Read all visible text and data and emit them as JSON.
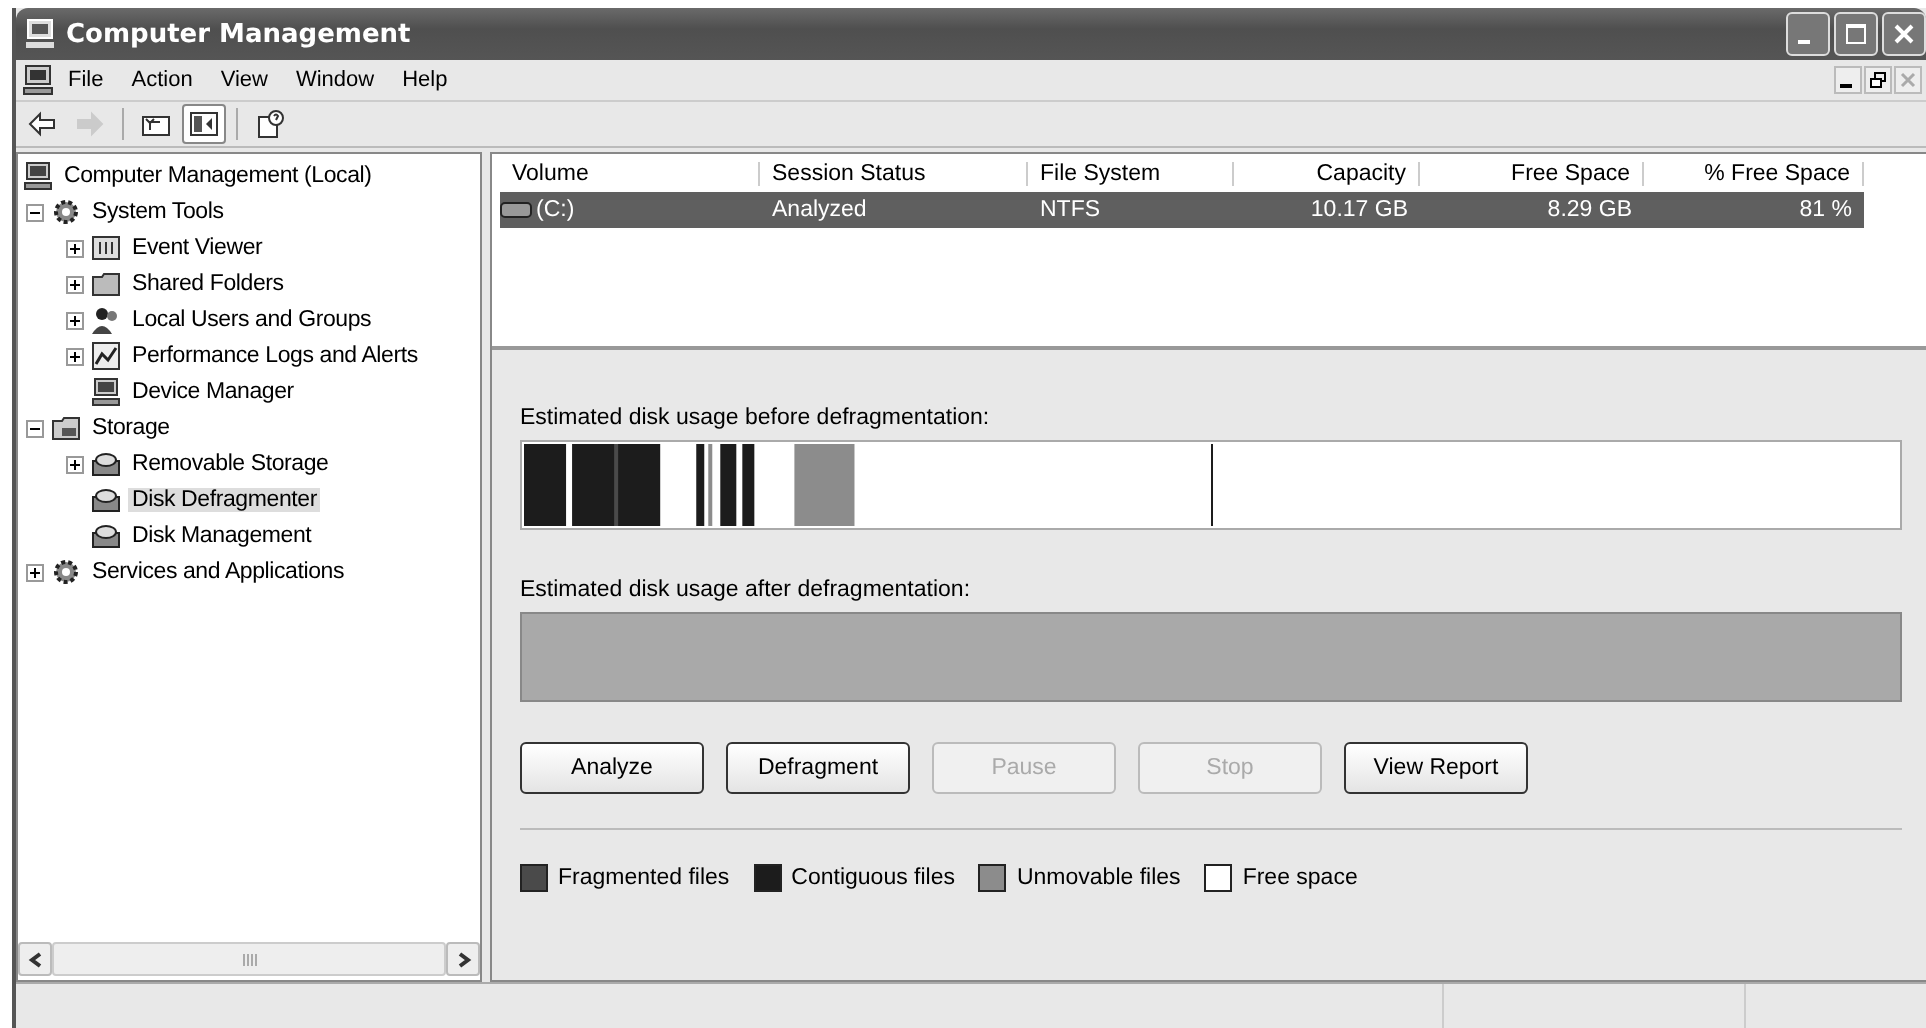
{
  "window": {
    "title": "Computer Management"
  },
  "menu": [
    "File",
    "Action",
    "View",
    "Window",
    "Help"
  ],
  "toolbar": [
    {
      "kind": "back",
      "disabled": false,
      "pressed": false
    },
    {
      "kind": "forward",
      "disabled": true,
      "pressed": false
    },
    {
      "kind": "up-folder",
      "disabled": false,
      "pressed": false
    },
    {
      "kind": "tree-toggle",
      "disabled": false,
      "pressed": true
    },
    {
      "kind": "help",
      "disabled": false,
      "pressed": false
    }
  ],
  "tree": {
    "items": [
      {
        "label": "Computer Management (Local)",
        "kind": "computer",
        "selected": false,
        "children": [
          {
            "label": "System Tools",
            "kind": "tools",
            "selected": false,
            "expanded": true,
            "children": [
              {
                "label": "Event Viewer",
                "kind": "log",
                "selected": false,
                "expanded": false
              },
              {
                "label": "Shared Folders",
                "kind": "folder",
                "selected": false,
                "expanded": false
              },
              {
                "label": "Local Users and Groups",
                "kind": "users",
                "selected": false,
                "expanded": false
              },
              {
                "label": "Performance Logs and Alerts",
                "kind": "chart",
                "selected": false,
                "expanded": false
              },
              {
                "label": "Device Manager",
                "kind": "computer",
                "selected": false
              }
            ]
          },
          {
            "label": "Storage",
            "kind": "storage",
            "selected": false,
            "expanded": true,
            "children": [
              {
                "label": "Removable Storage",
                "kind": "disk",
                "selected": false,
                "expanded": false
              },
              {
                "label": "Disk Defragmenter",
                "kind": "disk",
                "selected": true
              },
              {
                "label": "Disk Management",
                "kind": "disk",
                "selected": false
              }
            ]
          },
          {
            "label": "Services and Applications",
            "kind": "tools",
            "selected": false,
            "expanded": false
          }
        ]
      }
    ]
  },
  "volumes": {
    "columns": [
      {
        "label": "Volume"
      },
      {
        "label": "Session Status"
      },
      {
        "label": "File System"
      },
      {
        "label": "Capacity"
      },
      {
        "label": "Free Space"
      },
      {
        "label": "% Free Space"
      }
    ],
    "rows": [
      {
        "selected": true,
        "cells": [
          "(C:)",
          "Analyzed",
          "NTFS",
          "10.17 GB",
          "8.29 GB",
          "81 %"
        ]
      }
    ]
  },
  "analysis": {
    "before_label": "Estimated disk usage before defragmentation:",
    "after_label": "Estimated disk usage after defragmentation:",
    "buttons": [
      {
        "label": "Analyze",
        "disabled": false
      },
      {
        "label": "Defragment",
        "disabled": false
      },
      {
        "label": "Pause",
        "disabled": true
      },
      {
        "label": "Stop",
        "disabled": true
      },
      {
        "label": "View Report",
        "disabled": false
      }
    ],
    "legend": [
      {
        "label": "Fragmented files",
        "color": "#4a4a4a"
      },
      {
        "label": "Contiguous files",
        "color": "#1c1c1c"
      },
      {
        "label": "Unmovable files",
        "color": "#8c8c8c"
      },
      {
        "label": "Free space",
        "color": "#ffffff"
      }
    ]
  }
}
